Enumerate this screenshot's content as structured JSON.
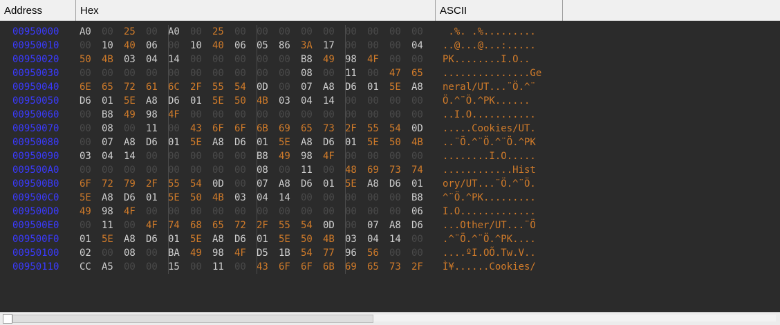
{
  "header": {
    "address": "Address",
    "hex": "Hex",
    "ascii": "ASCII"
  },
  "rows": [
    {
      "address": "00950000",
      "bytes": [
        "A0",
        "00",
        "25",
        "00",
        "A0",
        "00",
        "25",
        "00",
        "00",
        "00",
        "00",
        "00",
        "00",
        "00",
        "00",
        "00"
      ],
      "ascii": " .%. .%........."
    },
    {
      "address": "00950010",
      "bytes": [
        "00",
        "10",
        "40",
        "06",
        "00",
        "10",
        "40",
        "06",
        "05",
        "86",
        "3A",
        "17",
        "00",
        "00",
        "00",
        "04"
      ],
      "ascii": "..@...@...:....."
    },
    {
      "address": "00950020",
      "bytes": [
        "50",
        "4B",
        "03",
        "04",
        "14",
        "00",
        "00",
        "00",
        "00",
        "00",
        "B8",
        "49",
        "98",
        "4F",
        "00",
        "00"
      ],
      "ascii": "PK........I.O.."
    },
    {
      "address": "00950030",
      "bytes": [
        "00",
        "00",
        "00",
        "00",
        "00",
        "00",
        "00",
        "00",
        "00",
        "00",
        "08",
        "00",
        "11",
        "00",
        "47",
        "65"
      ],
      "ascii": "...............Ge"
    },
    {
      "address": "00950040",
      "bytes": [
        "6E",
        "65",
        "72",
        "61",
        "6C",
        "2F",
        "55",
        "54",
        "0D",
        "00",
        "07",
        "A8",
        "D6",
        "01",
        "5E",
        "A8"
      ],
      "ascii": "neral/UT...¨Ö.^¨"
    },
    {
      "address": "00950050",
      "bytes": [
        "D6",
        "01",
        "5E",
        "A8",
        "D6",
        "01",
        "5E",
        "50",
        "4B",
        "03",
        "04",
        "14",
        "00",
        "00",
        "00",
        "00"
      ],
      "ascii": "Ö.^¨Ö.^PK......"
    },
    {
      "address": "00950060",
      "bytes": [
        "00",
        "B8",
        "49",
        "98",
        "4F",
        "00",
        "00",
        "00",
        "00",
        "00",
        "00",
        "00",
        "00",
        "00",
        "00",
        "00"
      ],
      "ascii": "..I.O..........."
    },
    {
      "address": "00950070",
      "bytes": [
        "00",
        "08",
        "00",
        "11",
        "00",
        "43",
        "6F",
        "6F",
        "6B",
        "69",
        "65",
        "73",
        "2F",
        "55",
        "54",
        "0D"
      ],
      "ascii": ".....Cookies/UT."
    },
    {
      "address": "00950080",
      "bytes": [
        "00",
        "07",
        "A8",
        "D6",
        "01",
        "5E",
        "A8",
        "D6",
        "01",
        "5E",
        "A8",
        "D6",
        "01",
        "5E",
        "50",
        "4B"
      ],
      "ascii": "..¨Ö.^¨Ö.^¨Ö.^PK"
    },
    {
      "address": "00950090",
      "bytes": [
        "03",
        "04",
        "14",
        "00",
        "00",
        "00",
        "00",
        "00",
        "B8",
        "49",
        "98",
        "4F",
        "00",
        "00",
        "00",
        "00"
      ],
      "ascii": "........I.O....."
    },
    {
      "address": "009500A0",
      "bytes": [
        "00",
        "00",
        "00",
        "00",
        "00",
        "00",
        "00",
        "00",
        "08",
        "00",
        "11",
        "00",
        "48",
        "69",
        "73",
        "74"
      ],
      "ascii": "............Hist"
    },
    {
      "address": "009500B0",
      "bytes": [
        "6F",
        "72",
        "79",
        "2F",
        "55",
        "54",
        "0D",
        "00",
        "07",
        "A8",
        "D6",
        "01",
        "5E",
        "A8",
        "D6",
        "01"
      ],
      "ascii": "ory/UT...¨Ö.^¨Ö."
    },
    {
      "address": "009500C0",
      "bytes": [
        "5E",
        "A8",
        "D6",
        "01",
        "5E",
        "50",
        "4B",
        "03",
        "04",
        "14",
        "00",
        "00",
        "00",
        "00",
        "00",
        "B8"
      ],
      "ascii": "^¨Ö.^PK........."
    },
    {
      "address": "009500D0",
      "bytes": [
        "49",
        "98",
        "4F",
        "00",
        "00",
        "00",
        "00",
        "00",
        "00",
        "00",
        "00",
        "00",
        "00",
        "00",
        "00",
        "06"
      ],
      "ascii": "I.O............."
    },
    {
      "address": "009500E0",
      "bytes": [
        "00",
        "11",
        "00",
        "4F",
        "74",
        "68",
        "65",
        "72",
        "2F",
        "55",
        "54",
        "0D",
        "00",
        "07",
        "A8",
        "D6"
      ],
      "ascii": "...Other/UT...¨Ö"
    },
    {
      "address": "009500F0",
      "bytes": [
        "01",
        "5E",
        "A8",
        "D6",
        "01",
        "5E",
        "A8",
        "D6",
        "01",
        "5E",
        "50",
        "4B",
        "03",
        "04",
        "14",
        "00"
      ],
      "ascii": ".^¨Ö.^¨Ö.^PK...."
    },
    {
      "address": "00950100",
      "bytes": [
        "02",
        "00",
        "08",
        "00",
        "BA",
        "49",
        "98",
        "4F",
        "D5",
        "1B",
        "54",
        "77",
        "96",
        "56",
        "00",
        "00"
      ],
      "ascii": "....ºI.OÕ.Tw.V.."
    },
    {
      "address": "00950110",
      "bytes": [
        "CC",
        "A5",
        "00",
        "00",
        "15",
        "00",
        "11",
        "00",
        "43",
        "6F",
        "6F",
        "6B",
        "69",
        "65",
        "73",
        "2F"
      ],
      "ascii": "Ì¥......Cookies/"
    }
  ]
}
